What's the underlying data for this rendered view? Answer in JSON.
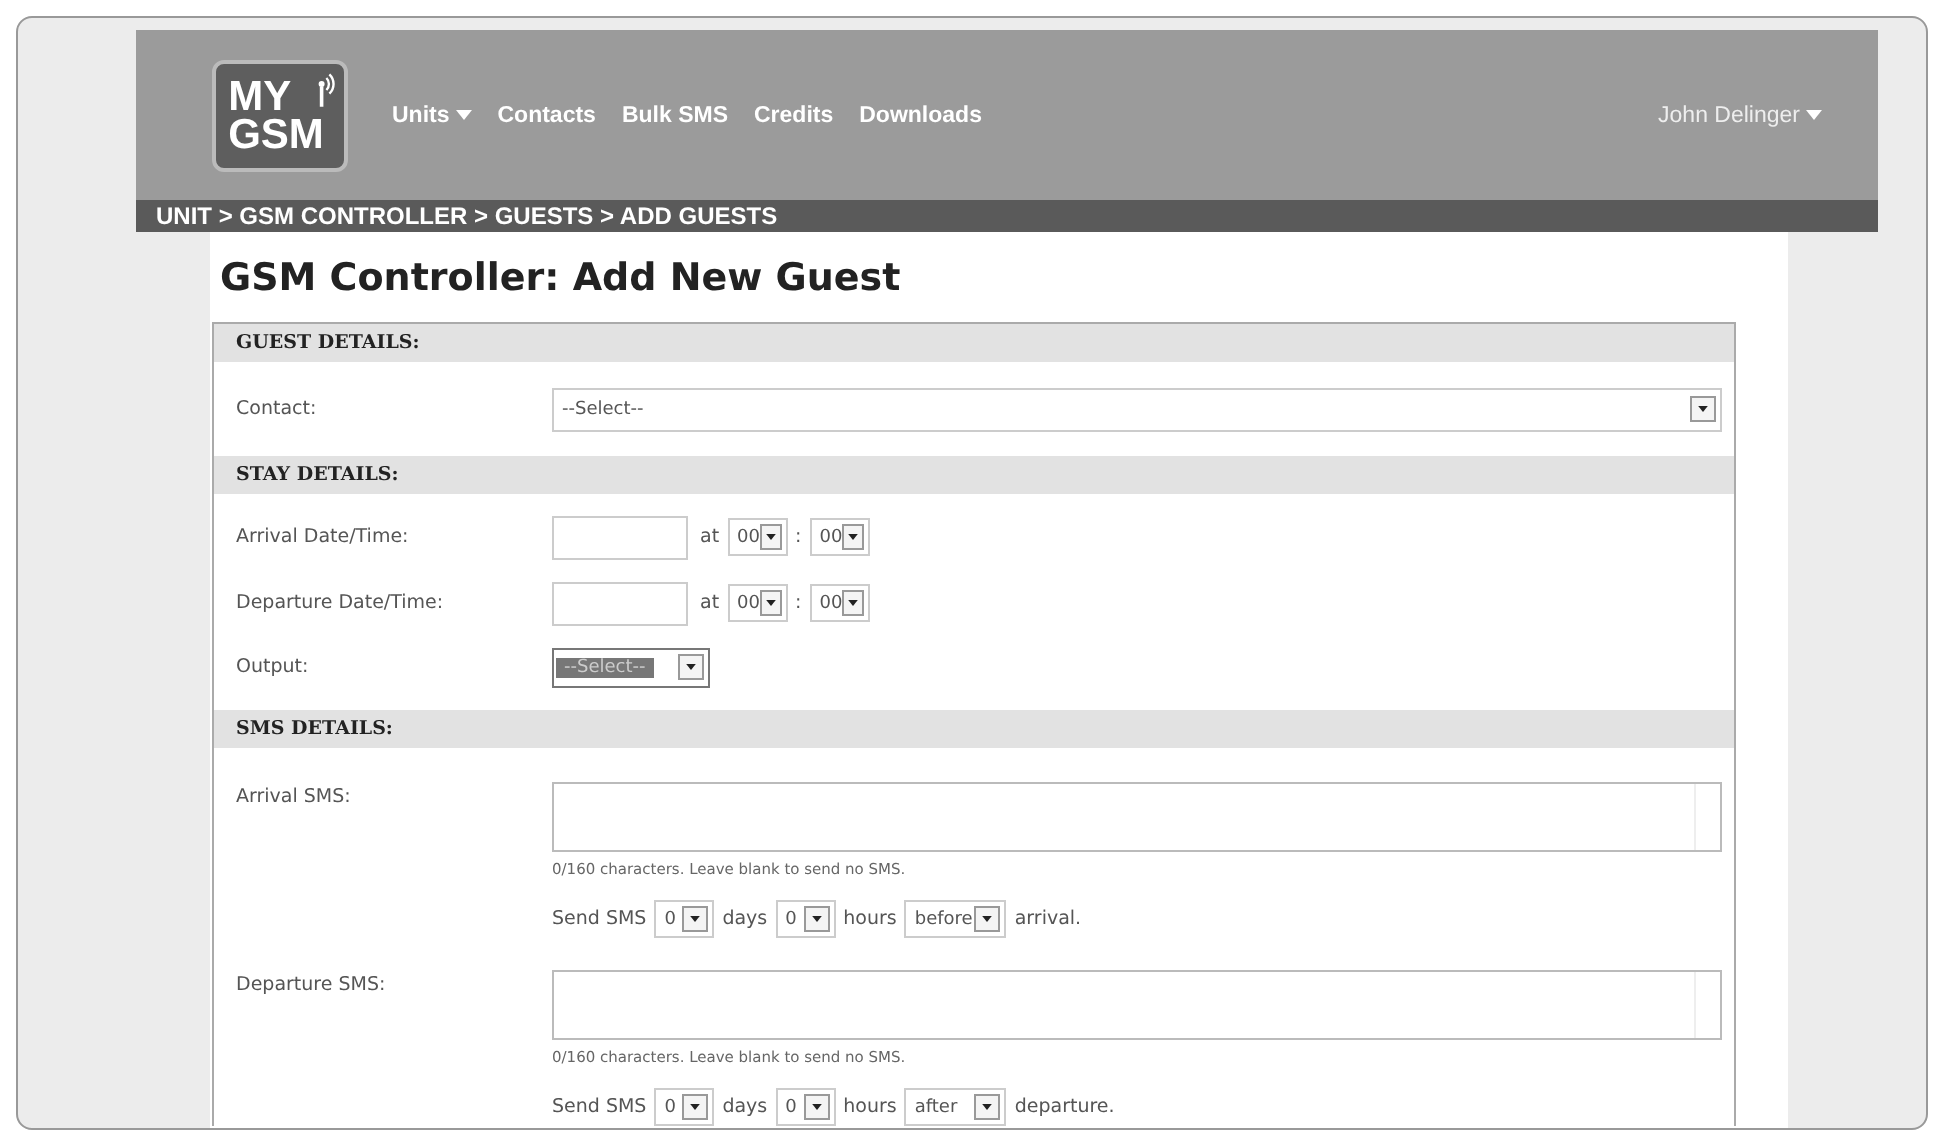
{
  "header": {
    "logo": [
      "MY",
      "GSM"
    ],
    "nav": [
      {
        "label": "Units",
        "dropdown": true
      },
      {
        "label": "Contacts",
        "dropdown": false
      },
      {
        "label": "Bulk SMS",
        "dropdown": false
      },
      {
        "label": "Credits",
        "dropdown": false
      },
      {
        "label": "Downloads",
        "dropdown": false
      }
    ],
    "user": {
      "label": "John Delinger",
      "dropdown": true
    }
  },
  "breadcrumb": "UNIT > GSM CONTROLLER > GUESTS > ADD GUESTS",
  "title": "GSM Controller: Add New Guest",
  "sections": [
    {
      "title": "GUEST DETAILS:",
      "rows": [
        {
          "kind": "select",
          "label": "Contact:",
          "value": "--Select--"
        }
      ]
    },
    {
      "title": "STAY DETAILS:",
      "rows": [
        {
          "kind": "datetime",
          "label": "Arrival Date/Time:",
          "at": "at",
          "hour": "00",
          "sep": ":",
          "minute": "00"
        },
        {
          "kind": "datetime",
          "label": "Departure Date/Time:",
          "at": "at",
          "hour": "00",
          "sep": ":",
          "minute": "00"
        },
        {
          "kind": "small_select",
          "label": "Output:",
          "value": "--Select--",
          "focused": true
        }
      ]
    },
    {
      "title": "SMS DETAILS:",
      "rows": [
        {
          "kind": "sms",
          "label": "Arrival SMS:",
          "hint": "0/160 characters.  Leave blank to send no SMS.",
          "schedule": [
            {
              "kind": "text",
              "text": "Send SMS"
            },
            {
              "kind": "select",
              "value": "0"
            },
            {
              "kind": "text",
              "text": "days"
            },
            {
              "kind": "select",
              "value": "0"
            },
            {
              "kind": "text",
              "text": "hours"
            },
            {
              "kind": "select",
              "value": "before"
            },
            {
              "kind": "text",
              "text": "arrival."
            }
          ]
        },
        {
          "kind": "sms",
          "label": "Departure SMS:",
          "hint": "0/160 characters.  Leave blank to send no SMS.",
          "schedule": [
            {
              "kind": "text",
              "text": "Send SMS"
            },
            {
              "kind": "select",
              "value": "0"
            },
            {
              "kind": "text",
              "text": "days"
            },
            {
              "kind": "select",
              "value": "0"
            },
            {
              "kind": "text",
              "text": "hours"
            },
            {
              "kind": "select",
              "value": "after"
            },
            {
              "kind": "text",
              "text": "departure."
            }
          ]
        }
      ]
    }
  ]
}
